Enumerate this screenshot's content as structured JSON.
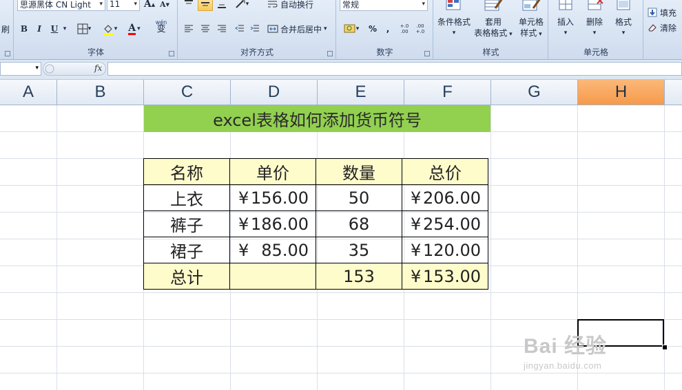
{
  "ribbon": {
    "clipboard_fragment": "刷",
    "font": {
      "font_name": "思源黑体 CN Light",
      "font_size": "11",
      "grow_label": "A",
      "shrink_label": "A",
      "bold": "B",
      "italic": "I",
      "underline": "U",
      "font_color_label": "A",
      "phonetic_label": "wén",
      "phonetic_char": "变",
      "group_label": "字体"
    },
    "alignment": {
      "wrap_text": "自动换行",
      "merge_center": "合并后居中",
      "group_label": "对齐方式"
    },
    "number": {
      "format_value": "常规",
      "percent": "%",
      "comma": ",",
      "inc_decimal": "+.0 .00",
      "dec_decimal": ".00 +.0",
      "group_label": "数字"
    },
    "styles": {
      "conditional": "条件格式",
      "table_format_line1": "套用",
      "table_format_line2": "表格格式",
      "cell_styles_line1": "单元格",
      "cell_styles_line2": "样式",
      "group_label": "样式"
    },
    "cells": {
      "insert": "插入",
      "delete": "删除",
      "format": "格式",
      "group_label": "单元格"
    },
    "editing": {
      "fill": "填充",
      "clear": "清除"
    }
  },
  "formula_bar": {
    "name_box": "",
    "fx_label": "fx",
    "content": ""
  },
  "columns": [
    "A",
    "B",
    "C",
    "D",
    "E",
    "F",
    "G",
    "H"
  ],
  "active_column": "H",
  "sheet": {
    "title": "excel表格如何添加货币符号",
    "headers": [
      "名称",
      "单价",
      "数量",
      "总价"
    ],
    "currency_symbol": "¥",
    "rows": [
      {
        "name": "上衣",
        "price": "156.00",
        "qty": "50",
        "total": "206.00"
      },
      {
        "name": "裤子",
        "price": "186.00",
        "qty": "68",
        "total": "254.00"
      },
      {
        "name": "裙子",
        "price": "85.00",
        "qty": "35",
        "total": "120.00"
      }
    ],
    "total_row": {
      "name": "总计",
      "price": "",
      "qty": "153",
      "total": "153.00"
    }
  },
  "watermark": {
    "brand": "Bai 经验",
    "url": "jingyan.baidu.com"
  },
  "colors": {
    "title_fill": "#92d050",
    "header_fill": "#fffccc",
    "active_column": "#f69a4a"
  }
}
